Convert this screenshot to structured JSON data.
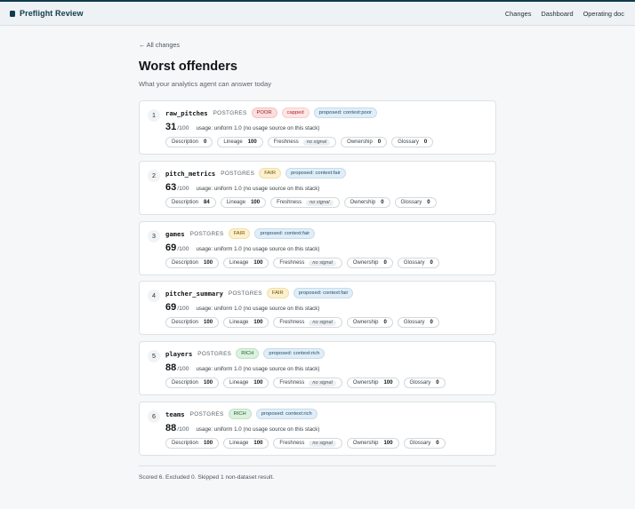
{
  "brand": {
    "title": "Preflight Review"
  },
  "nav": [
    {
      "label": "Changes"
    },
    {
      "label": "Dashboard"
    },
    {
      "label": "Operating doc"
    }
  ],
  "back_link": "← All changes",
  "heading": "Worst offenders",
  "subtitle": "What your analytics agent can answer today",
  "score_suffix": "/100",
  "usage_text": "usage: uniform 1.0 (no usage source on this stack)",
  "no_signal_text": "no signal",
  "colors": {
    "brand": "#0f3b4a",
    "poor": "#9a1c1c",
    "fair": "#7a5200",
    "rich": "#21622f",
    "context": "#1f4e6e"
  },
  "offenders": [
    {
      "rank": "1",
      "name": "raw_pitches",
      "engine": "POSTGRES",
      "tags": [
        {
          "label": "POOR",
          "kind": "poor"
        },
        {
          "label": "capped",
          "kind": "capped"
        },
        {
          "label": "proposed: context:poor",
          "kind": "ctx"
        }
      ],
      "score": "31",
      "metrics": [
        {
          "label": "Description",
          "value": "0"
        },
        {
          "label": "Lineage",
          "value": "100"
        },
        {
          "label": "Freshness",
          "value": null
        },
        {
          "label": "Ownership",
          "value": "0"
        },
        {
          "label": "Glossary",
          "value": "0"
        }
      ]
    },
    {
      "rank": "2",
      "name": "pitch_metrics",
      "engine": "POSTGRES",
      "tags": [
        {
          "label": "FAIR",
          "kind": "fair"
        },
        {
          "label": "proposed: context:fair",
          "kind": "ctx"
        }
      ],
      "score": "63",
      "metrics": [
        {
          "label": "Description",
          "value": "84"
        },
        {
          "label": "Lineage",
          "value": "100"
        },
        {
          "label": "Freshness",
          "value": null
        },
        {
          "label": "Ownership",
          "value": "0"
        },
        {
          "label": "Glossary",
          "value": "0"
        }
      ]
    },
    {
      "rank": "3",
      "name": "games",
      "engine": "POSTGRES",
      "tags": [
        {
          "label": "FAIR",
          "kind": "fair"
        },
        {
          "label": "proposed: context:fair",
          "kind": "ctx"
        }
      ],
      "score": "69",
      "metrics": [
        {
          "label": "Description",
          "value": "100"
        },
        {
          "label": "Lineage",
          "value": "100"
        },
        {
          "label": "Freshness",
          "value": null
        },
        {
          "label": "Ownership",
          "value": "0"
        },
        {
          "label": "Glossary",
          "value": "0"
        }
      ]
    },
    {
      "rank": "4",
      "name": "pitcher_summary",
      "engine": "POSTGRES",
      "tags": [
        {
          "label": "FAIR",
          "kind": "fair"
        },
        {
          "label": "proposed: context:fair",
          "kind": "ctx"
        }
      ],
      "score": "69",
      "metrics": [
        {
          "label": "Description",
          "value": "100"
        },
        {
          "label": "Lineage",
          "value": "100"
        },
        {
          "label": "Freshness",
          "value": null
        },
        {
          "label": "Ownership",
          "value": "0"
        },
        {
          "label": "Glossary",
          "value": "0"
        }
      ]
    },
    {
      "rank": "5",
      "name": "players",
      "engine": "POSTGRES",
      "tags": [
        {
          "label": "RICH",
          "kind": "rich"
        },
        {
          "label": "proposed: context:rich",
          "kind": "ctx"
        }
      ],
      "score": "88",
      "metrics": [
        {
          "label": "Description",
          "value": "100"
        },
        {
          "label": "Lineage",
          "value": "100"
        },
        {
          "label": "Freshness",
          "value": null
        },
        {
          "label": "Ownership",
          "value": "100"
        },
        {
          "label": "Glossary",
          "value": "0"
        }
      ]
    },
    {
      "rank": "6",
      "name": "teams",
      "engine": "POSTGRES",
      "tags": [
        {
          "label": "RICH",
          "kind": "rich"
        },
        {
          "label": "proposed: context:rich",
          "kind": "ctx"
        }
      ],
      "score": "88",
      "metrics": [
        {
          "label": "Description",
          "value": "100"
        },
        {
          "label": "Lineage",
          "value": "100"
        },
        {
          "label": "Freshness",
          "value": null
        },
        {
          "label": "Ownership",
          "value": "100"
        },
        {
          "label": "Glossary",
          "value": "0"
        }
      ]
    }
  ],
  "footer": "Scored 6. Excluded 0. Skipped 1 non-dataset result."
}
